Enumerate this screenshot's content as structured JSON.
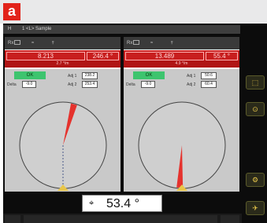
{
  "figure_label": "a",
  "header": {
    "home": "H",
    "title": "1 <L> Sample"
  },
  "panels": [
    {
      "status_rx": "Rx",
      "status_sig": "≈",
      "status_ant": "⫯",
      "readout_value": "8.213",
      "readout_angle": "246.4 °",
      "readout_sub": "2.7 °/m",
      "ok_label": "OK",
      "labels": {
        "delta": "Delta",
        "adj1": "Adj 1",
        "adj2": "Adj 2"
      },
      "fields": {
        "delta": "-9.0",
        "adj1": "238.2",
        "adj2": "253.4"
      },
      "needle_angle_deg": 15
    },
    {
      "status_rx": "Rx",
      "status_sig": "≈",
      "status_ant": "⫯",
      "readout_value": "13.489",
      "readout_angle": "55.4 °",
      "readout_sub": "4.9 °/m",
      "ok_label": "OK",
      "labels": {
        "delta": "Delta",
        "adj1": "Adj 1",
        "adj2": "Adj 2"
      },
      "fields": {
        "delta": "-9.0",
        "adj1": "50.6",
        "adj2": "60.4"
      },
      "needle_angle_deg": 183
    }
  ],
  "bottom_readout": {
    "icon": "⌖",
    "value": "53.4 °"
  },
  "right_buttons": [
    "⬚",
    "⊙",
    "⚙",
    "✈"
  ],
  "colors": {
    "accent_red": "#c81e1e",
    "ok_green": "#3dc46e",
    "needle_red": "#e5322d",
    "icon_yellow": "#e8c64a"
  }
}
